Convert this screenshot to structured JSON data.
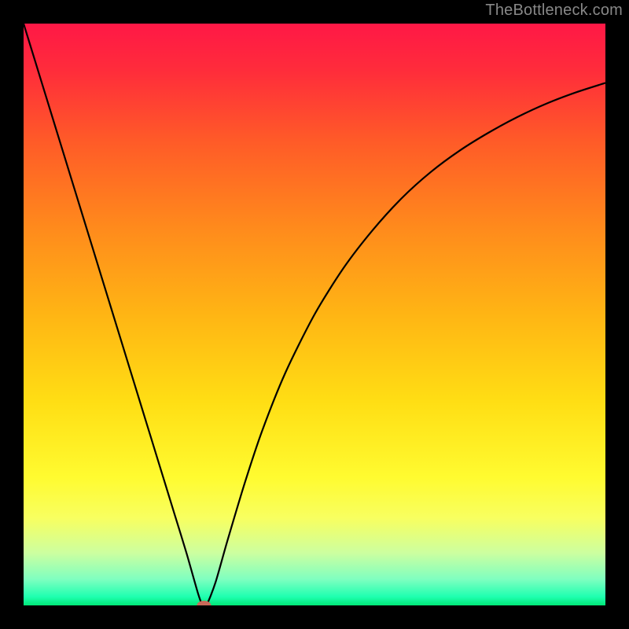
{
  "watermark": "TheBottleneck.com",
  "chart_data": {
    "type": "line",
    "title": "",
    "xlabel": "",
    "ylabel": "",
    "xlim": [
      0,
      100
    ],
    "ylim": [
      0,
      100
    ],
    "background_gradient": {
      "stops": [
        {
          "offset": 0.0,
          "color": "#ff1846"
        },
        {
          "offset": 0.08,
          "color": "#ff2c3b"
        },
        {
          "offset": 0.2,
          "color": "#ff5a28"
        },
        {
          "offset": 0.35,
          "color": "#ff8a1c"
        },
        {
          "offset": 0.5,
          "color": "#ffb514"
        },
        {
          "offset": 0.65,
          "color": "#ffde14"
        },
        {
          "offset": 0.78,
          "color": "#fffb30"
        },
        {
          "offset": 0.85,
          "color": "#f8ff60"
        },
        {
          "offset": 0.91,
          "color": "#ccffa0"
        },
        {
          "offset": 0.955,
          "color": "#7fffc0"
        },
        {
          "offset": 0.985,
          "color": "#1fffb0"
        },
        {
          "offset": 1.0,
          "color": "#00e878"
        }
      ]
    },
    "series": [
      {
        "name": "bottleneck-curve",
        "x": [
          0.0,
          2.0,
          4.0,
          6.0,
          8.0,
          10.0,
          12.0,
          14.0,
          16.0,
          18.0,
          20.0,
          22.0,
          24.0,
          26.0,
          28.0,
          30.0,
          30.7,
          31.5,
          33.0,
          35.0,
          38.0,
          41.0,
          45.0,
          50.0,
          55.0,
          60.0,
          65.0,
          70.0,
          75.0,
          80.0,
          85.0,
          90.0,
          95.0,
          100.0
        ],
        "y": [
          100.0,
          93.5,
          87.0,
          80.5,
          74.0,
          67.5,
          61.0,
          54.5,
          48.0,
          41.5,
          35.0,
          28.5,
          22.0,
          15.5,
          9.0,
          2.0,
          0.2,
          0.2,
          4.0,
          11.0,
          21.0,
          30.0,
          40.0,
          50.0,
          58.0,
          64.5,
          70.0,
          74.5,
          78.2,
          81.3,
          84.0,
          86.3,
          88.2,
          89.8
        ]
      }
    ],
    "minimum_marker": {
      "x": 31.0,
      "y": 0.0,
      "color": "#c96a5a",
      "rx": 9,
      "ry": 6
    }
  }
}
